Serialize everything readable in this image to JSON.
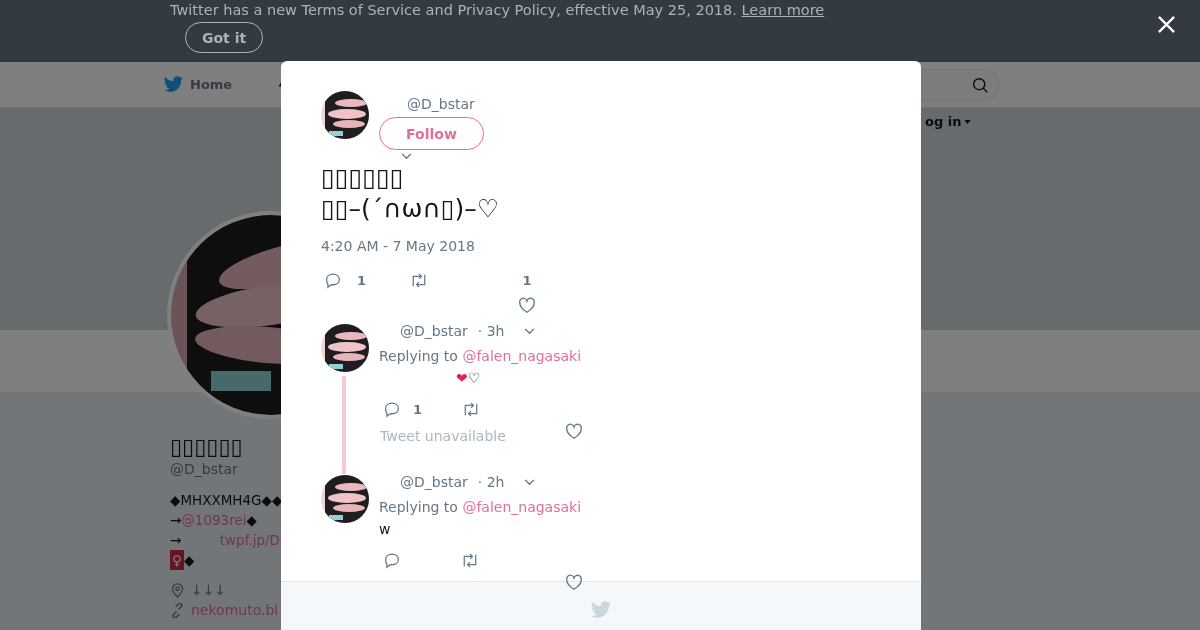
{
  "banner": {
    "message": "Twitter has a new Terms of Service and Privacy Policy, effective May 25, 2018.",
    "link": "Learn more",
    "button": "Got it"
  },
  "nav": {
    "home": "Home",
    "login": "og in"
  },
  "profile": {
    "name": "▯▯▯▯▯▯",
    "handle": "@D_bstar",
    "bio": [
      [
        {
          "kind": "text",
          "text": "◆MHXXMH4G◆◆"
        }
      ],
      [
        {
          "kind": "text",
          "text": "→"
        },
        {
          "kind": "link",
          "text": "@1093rei"
        },
        {
          "kind": "text",
          "text": "◆"
        }
      ],
      [
        {
          "kind": "text",
          "text": "→"
        },
        {
          "kind": "gap"
        },
        {
          "kind": "link",
          "text": "twpf.jp/D"
        }
      ],
      [
        {
          "kind": "badge",
          "text": "♀"
        },
        {
          "kind": "text",
          "text": "◆"
        }
      ]
    ],
    "location": "↓↓↓",
    "website": "nekomuto.bl"
  },
  "tweet": {
    "handle": "@D_bstar",
    "follow": "Follow",
    "lines": [
      "▯▯▯▯▯▯",
      "▯▯–(´∩ω∩▯)–♡"
    ],
    "time": "4:20 AM - 7 May 2018",
    "replies": "1",
    "likes": "1"
  },
  "replies": [
    {
      "handle": "@D_bstar",
      "age": "· 3h",
      "replying": "Replying to",
      "to": "@falen_nagasaki",
      "text": "❤♡",
      "replies": "1",
      "note": "Tweet unavailable"
    },
    {
      "handle": "@D_bstar",
      "age": "· 2h",
      "replying": "Replying to",
      "to": "@falen_nagasaki",
      "text": "w"
    }
  ]
}
